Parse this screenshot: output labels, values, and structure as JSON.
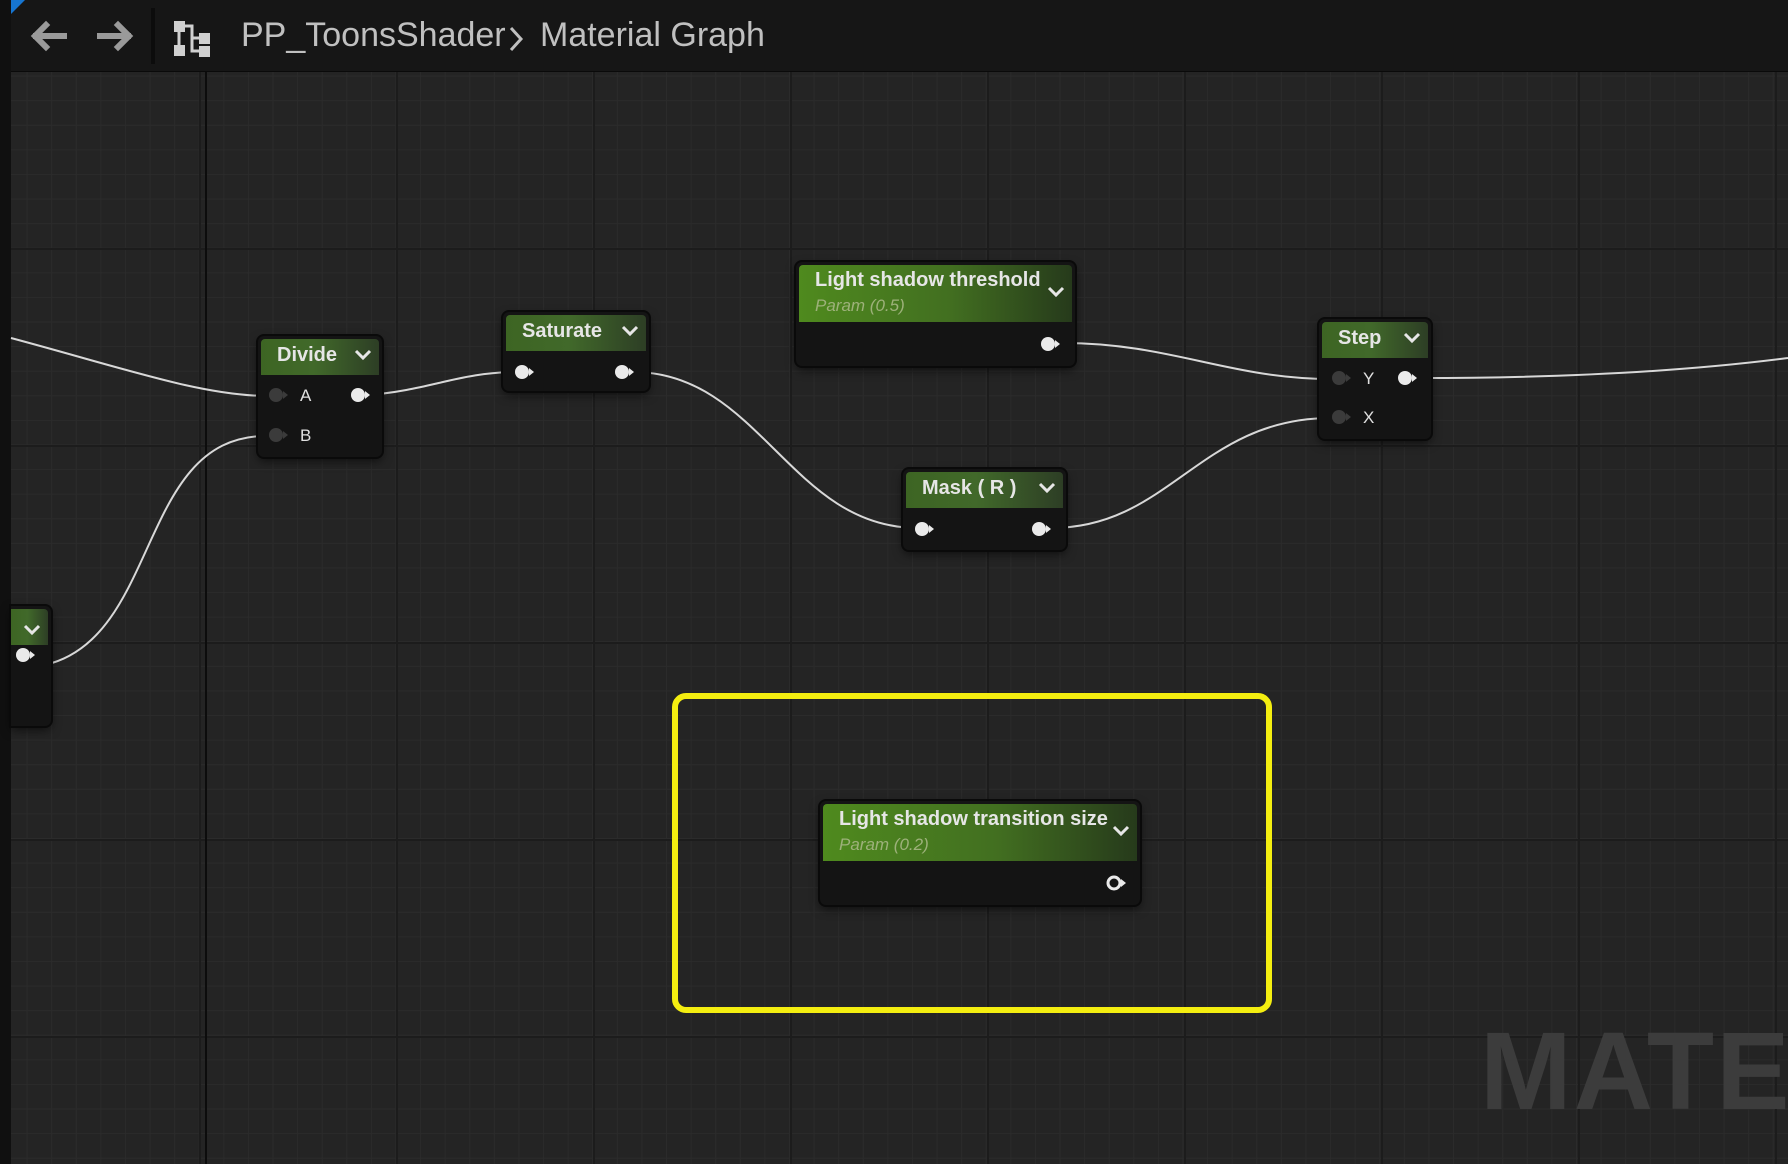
{
  "breadcrumb": {
    "asset": "PP_ToonsShader",
    "graph": "Material Graph"
  },
  "nodes": {
    "divide": {
      "title": "Divide",
      "pin_a": "A",
      "pin_b": "B"
    },
    "saturate": {
      "title": "Saturate"
    },
    "threshold": {
      "title": "Light shadow threshold",
      "subtitle": "Param (0.5)"
    },
    "mask": {
      "title": "Mask ( R )"
    },
    "step": {
      "title": "Step",
      "pin_y": "Y",
      "pin_x": "X"
    },
    "transition": {
      "title": "Light shadow transition size",
      "subtitle": "Param (0.2)"
    }
  },
  "watermark": "MATER",
  "colors": {
    "highlight": "#f4ee10",
    "node_header": "#41692a",
    "param_header": "#4f8a1e",
    "wire": "#d8d8d8",
    "accent": "#1675d1"
  }
}
